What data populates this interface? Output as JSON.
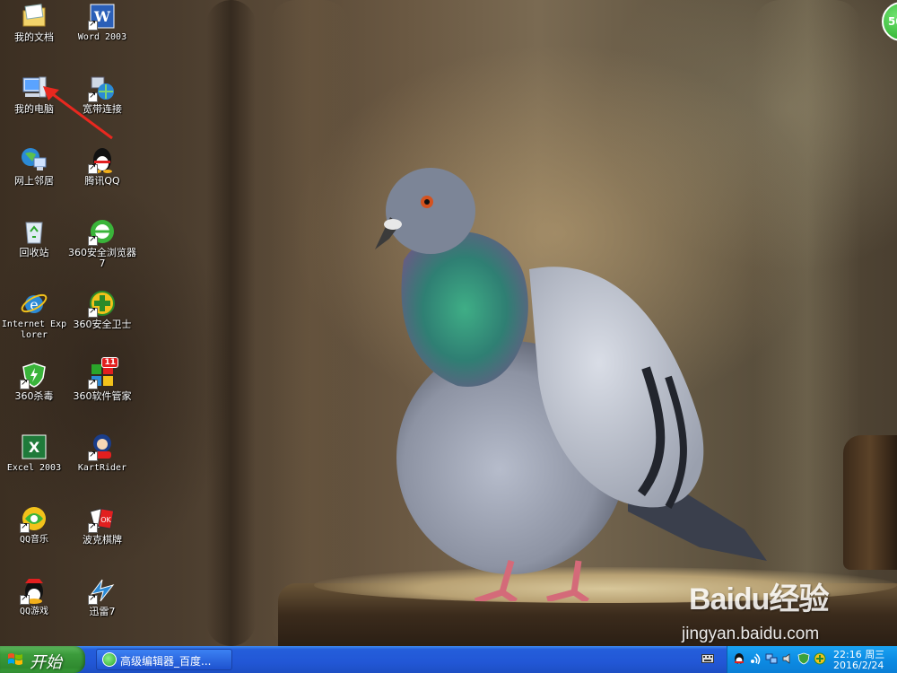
{
  "desktop": {
    "icons": [
      {
        "label": "我的文档",
        "icon": "my-documents-icon"
      },
      {
        "label": "Word 2003",
        "icon": "word-icon"
      },
      {
        "label": "我的电脑",
        "icon": "my-computer-icon"
      },
      {
        "label": "宽带连接",
        "icon": "broadband-connection-icon"
      },
      {
        "label": "网上邻居",
        "icon": "network-places-icon"
      },
      {
        "label": "腾讯QQ",
        "icon": "qq-penguin-icon"
      },
      {
        "label": "回收站",
        "icon": "recycle-bin-icon"
      },
      {
        "label": "360安全浏览器7",
        "icon": "360-browser-icon"
      },
      {
        "label": "Internet Explorer",
        "icon": "internet-explorer-icon"
      },
      {
        "label": "360安全卫士",
        "icon": "360-safeguard-icon"
      },
      {
        "label": "360杀毒",
        "icon": "360-antivirus-icon"
      },
      {
        "label": "360软件管家",
        "icon": "360-software-manager-icon"
      },
      {
        "label": "Excel 2003",
        "icon": "excel-icon"
      },
      {
        "label": "KartRider",
        "icon": "kartrider-icon"
      },
      {
        "label": "QQ音乐",
        "icon": "qq-music-icon"
      },
      {
        "label": "波克棋牌",
        "icon": "poker-games-icon"
      },
      {
        "label": "QQ游戏",
        "icon": "qq-games-icon"
      },
      {
        "label": "迅雷7",
        "icon": "thunder-icon"
      }
    ],
    "software_manager_badge": "11",
    "speed_badge": "50"
  },
  "watermark": {
    "logo_text": "Baidu经验",
    "url": "jingyan.baidu.com"
  },
  "taskbar": {
    "start_label": "开始",
    "task_window_label": "高级编辑器_百度...",
    "clock_time": "22:16 周三",
    "clock_date": "2016/2/24"
  },
  "colors": {
    "taskbar_blue": "#245edb",
    "start_green": "#3c9c3c",
    "tray_blue": "#0d8ce4",
    "arrow_red": "#e8281f"
  }
}
